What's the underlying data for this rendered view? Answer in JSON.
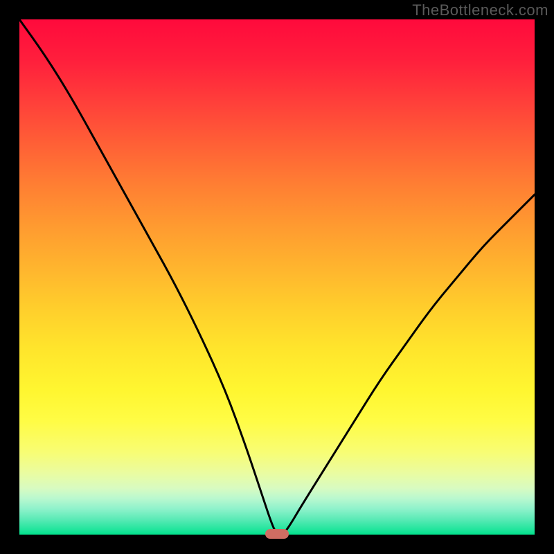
{
  "watermark": "TheBottleneck.com",
  "colors": {
    "frame": "#000000",
    "curve": "#000000",
    "marker": "#cf6d62"
  },
  "chart_data": {
    "type": "line",
    "title": "",
    "xlabel": "",
    "ylabel": "",
    "xlim": [
      0,
      100
    ],
    "ylim": [
      0,
      100
    ],
    "grid": false,
    "legend": false,
    "series": [
      {
        "name": "bottleneck-curve",
        "x": [
          0,
          5,
          10,
          15,
          20,
          25,
          30,
          35,
          40,
          44,
          47,
          49,
          50,
          51,
          52,
          55,
          60,
          65,
          70,
          75,
          80,
          85,
          90,
          95,
          100
        ],
        "y": [
          100,
          93,
          85,
          76,
          67,
          58,
          49,
          39,
          28,
          17,
          8,
          2,
          0,
          0,
          1,
          6,
          14,
          22,
          30,
          37,
          44,
          50,
          56,
          61,
          66
        ]
      }
    ],
    "marker": {
      "x": 50,
      "y": 0
    },
    "background_gradient": {
      "top": "#ff0a3c",
      "mid": "#ffe52c",
      "bottom": "#02e18c"
    }
  }
}
